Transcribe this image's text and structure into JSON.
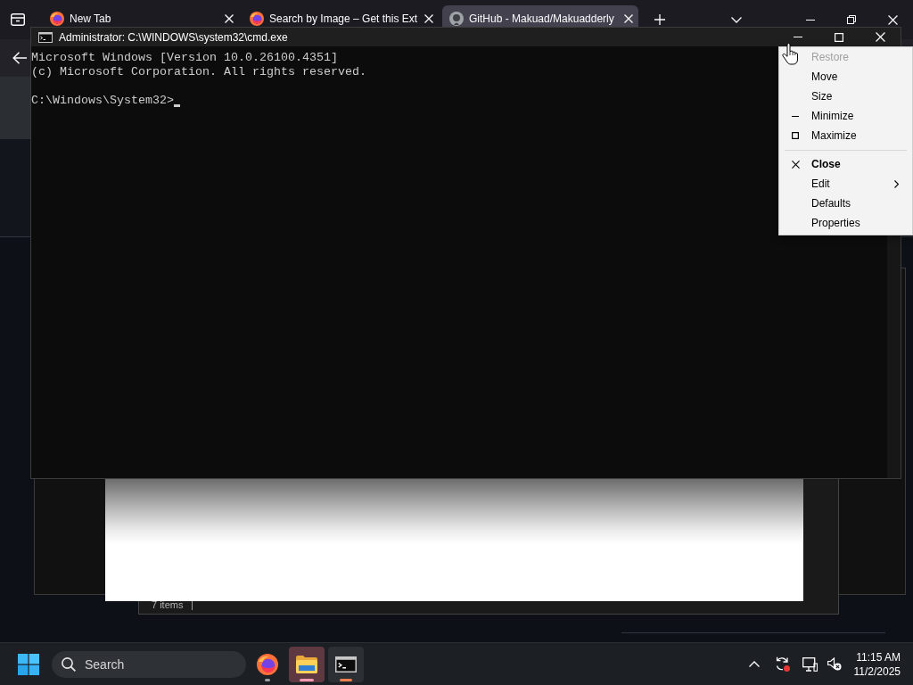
{
  "browser": {
    "tabs": [
      {
        "title": "New Tab",
        "kind": "browser",
        "selected": false
      },
      {
        "title": "Search by Image – Get this Ext",
        "kind": "browser",
        "selected": false
      },
      {
        "title": "GitHub - Makuad/Makuadderly",
        "kind": "site",
        "selected": true
      }
    ]
  },
  "console_window": {
    "title": "Administrator: C:\\WINDOWS\\system32\\cmd.exe",
    "output": [
      "Microsoft Windows [Version 10.0.26100.4351]",
      "(c) Microsoft Corporation. All rights reserved."
    ],
    "prompt": "C:\\Windows\\System32>"
  },
  "system_menu": {
    "groups": [
      {
        "items": [
          {
            "label": "Restore",
            "kind": "plain",
            "disabled": true,
            "default": false
          },
          {
            "label": "Move",
            "kind": "plain",
            "disabled": false,
            "default": false
          },
          {
            "label": "Size",
            "kind": "plain",
            "disabled": false,
            "default": false
          },
          {
            "label": "Minimize",
            "kind": "minimize",
            "disabled": false,
            "default": false
          },
          {
            "label": "Maximize",
            "kind": "maximize",
            "disabled": false,
            "default": false
          }
        ]
      },
      {
        "items": [
          {
            "label": "Close",
            "kind": "close",
            "disabled": false,
            "default": true
          },
          {
            "label": "Edit",
            "kind": "submenu",
            "disabled": false,
            "default": false
          },
          {
            "label": "Defaults",
            "kind": "plain",
            "disabled": false,
            "default": false
          },
          {
            "label": "Properties",
            "kind": "plain",
            "disabled": false,
            "default": false
          }
        ]
      }
    ]
  },
  "explorer_window": {
    "status": "7 items"
  },
  "taskbar": {
    "search": {
      "placeholder": "Search"
    },
    "apps": [
      {
        "kind": "browser",
        "focused": false,
        "flashing": false
      },
      {
        "kind": "files",
        "focused": false,
        "flashing": true
      },
      {
        "kind": "console",
        "focused": true,
        "flashing": false
      }
    ],
    "clock": {
      "time": "11:15 AM",
      "date": "11/2/2025"
    }
  }
}
